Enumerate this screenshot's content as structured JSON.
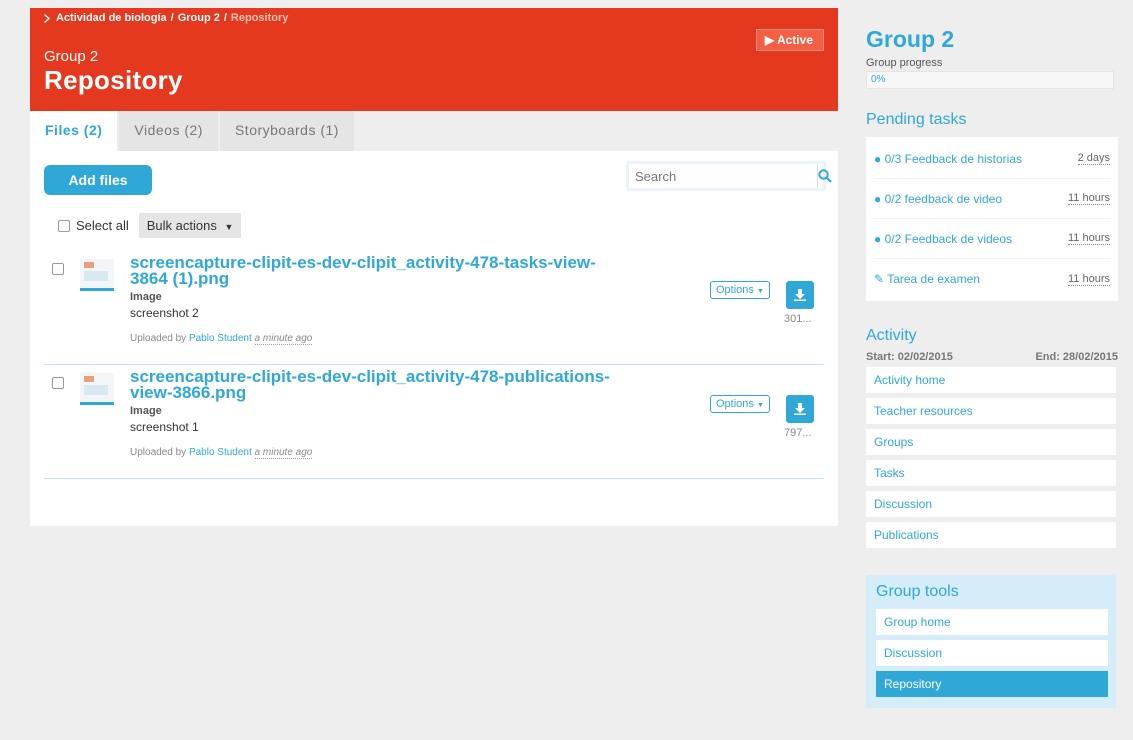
{
  "breadcrumb": {
    "items": [
      "Actividad de biología",
      "Group 2"
    ],
    "current": "Repository"
  },
  "header": {
    "subtitle": "Group 2",
    "title": "Repository",
    "status": "Active",
    "accent_color": "#e4391f"
  },
  "tabs": [
    {
      "label": "Files (2)",
      "active": true
    },
    {
      "label": "Videos (2)",
      "active": false
    },
    {
      "label": "Storyboards (1)",
      "active": false
    }
  ],
  "toolbar": {
    "add_files_label": "Add files",
    "search_placeholder": "Search",
    "select_all_label": "Select all",
    "bulk_actions_label": "Bulk actions"
  },
  "files": [
    {
      "name": "screencapture-clipit-es-dev-clipit_activity-478-tasks-view-3864 (1).png",
      "type": "Image",
      "description": "screenshot 2",
      "uploaded_prefix": "Uploaded by",
      "uploader": "Pablo Student",
      "time": "a minute ago",
      "options_label": "Options",
      "size": "301..."
    },
    {
      "name": "screencapture-clipit-es-dev-clipit_activity-478-publications-view-3866.png",
      "type": "Image",
      "description": "screenshot 1",
      "uploaded_prefix": "Uploaded by",
      "uploader": "Pablo Student",
      "time": "a minute ago",
      "options_label": "Options",
      "size": "797..."
    }
  ],
  "sidebar": {
    "group_title": "Group 2",
    "progress_label": "Group progress",
    "progress_value": "0%",
    "pending_heading": "Pending tasks",
    "tasks": [
      {
        "label": "0/3 Feedback de historias",
        "due": "2 days",
        "icon": "comment-icon"
      },
      {
        "label": "0/2 feedback de video",
        "due": "11 hours",
        "icon": "comment-icon"
      },
      {
        "label": "0/2 Feedback de videos",
        "due": "11 hours",
        "icon": "comment-icon"
      },
      {
        "label": "Tarea de examen",
        "due": "11 hours",
        "icon": "edit-icon"
      }
    ],
    "activity_heading": "Activity",
    "start_label": "Start: 02/02/2015",
    "end_label": "End: 28/02/2015",
    "activity_links": [
      "Activity home",
      "Teacher resources",
      "Groups",
      "Tasks",
      "Discussion",
      "Publications"
    ],
    "tools_heading": "Group tools",
    "tool_links": [
      "Group home",
      "Discussion",
      "Repository"
    ],
    "brand_color": "#2fa8d8"
  }
}
